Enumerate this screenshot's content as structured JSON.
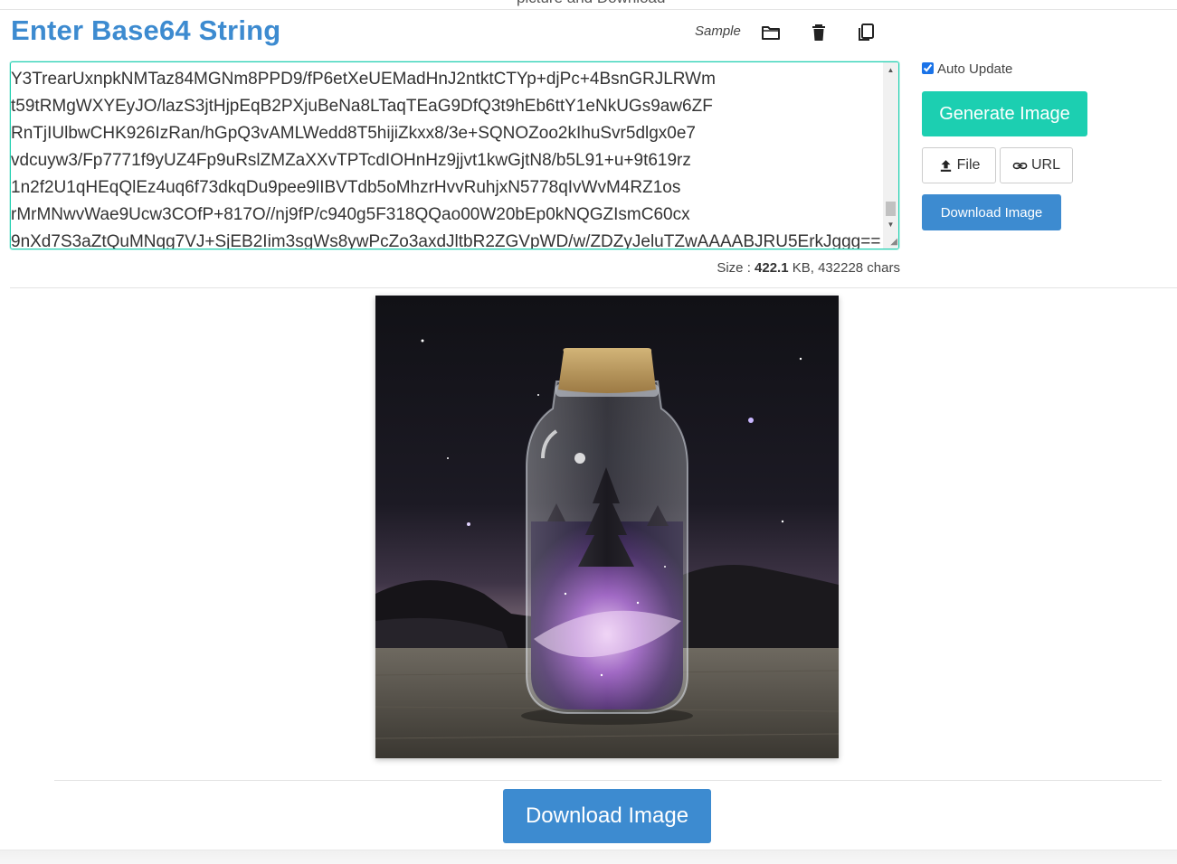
{
  "top_clip_text": "picture and Download",
  "title": "Enter Base64 String",
  "toolbar": {
    "sample_label": "Sample",
    "icons": [
      "folder-icon",
      "trash-icon",
      "copy-icon"
    ]
  },
  "base64_lines": [
    "Y3TrearUxnpkNMTaz84MGNm8PPD9/fP6etXeUEMadHnJ2ntktCTYp+djPc+4BsnGRJLRWm",
    "t59tRMgWXYEyJO/lazS3jtHjpEqB2PXjuBeNa8LTaqTEaG9DfQ3t9hEb6ttY1eNkUGs9aw6ZF",
    "RnTjIUlbwCHK926IzRan/hGpQ3vAMLWedd8T5hijiZkxx8/3e+SQNOZoo2kIhuSvr5dlgx0e7",
    "vdcuyw3/Fp7771f9yUZ4Fp9uRslZMZaXXvTPTcdIOHnHz9jjvt1kwGjtN8/b5L91+u+9t619rz",
    "1n2f2U1qHEqQlEz4uq6f73dkqDu9pee9lIBVTdb5oMhzrHvvRuhjxN5778qIvWvM4RZ1os",
    "rMrMNwvWae9Ucw3COfP+817O//nj9fP/c940g5F318QQao00W20bEp0kNQGZIsmC60cx",
    "9nXd7S3aZtQuMNqg7VJ+SjEB2Iim3sgWs8ywPcZo3axdJltbR2ZGVpWD/w/ZDZyJeluTZwAAAABJRU5ErkJggg=="
  ],
  "size": {
    "prefix": "Size : ",
    "kb_value": "422.1",
    "suffix": " KB, 432228 chars"
  },
  "auto_update": {
    "label": "Auto Update",
    "checked": true
  },
  "buttons": {
    "generate": "Generate Image",
    "file": "File",
    "url": "URL",
    "download_small": "Download Image",
    "download_large": "Download Image"
  },
  "colors": {
    "title": "#3d8bd0",
    "generate_bg": "#1ccfb1",
    "download_bg": "#3d8bd0",
    "textarea_border": "#1fcfb0"
  },
  "preview_image": {
    "description_icon": "image-preview"
  }
}
